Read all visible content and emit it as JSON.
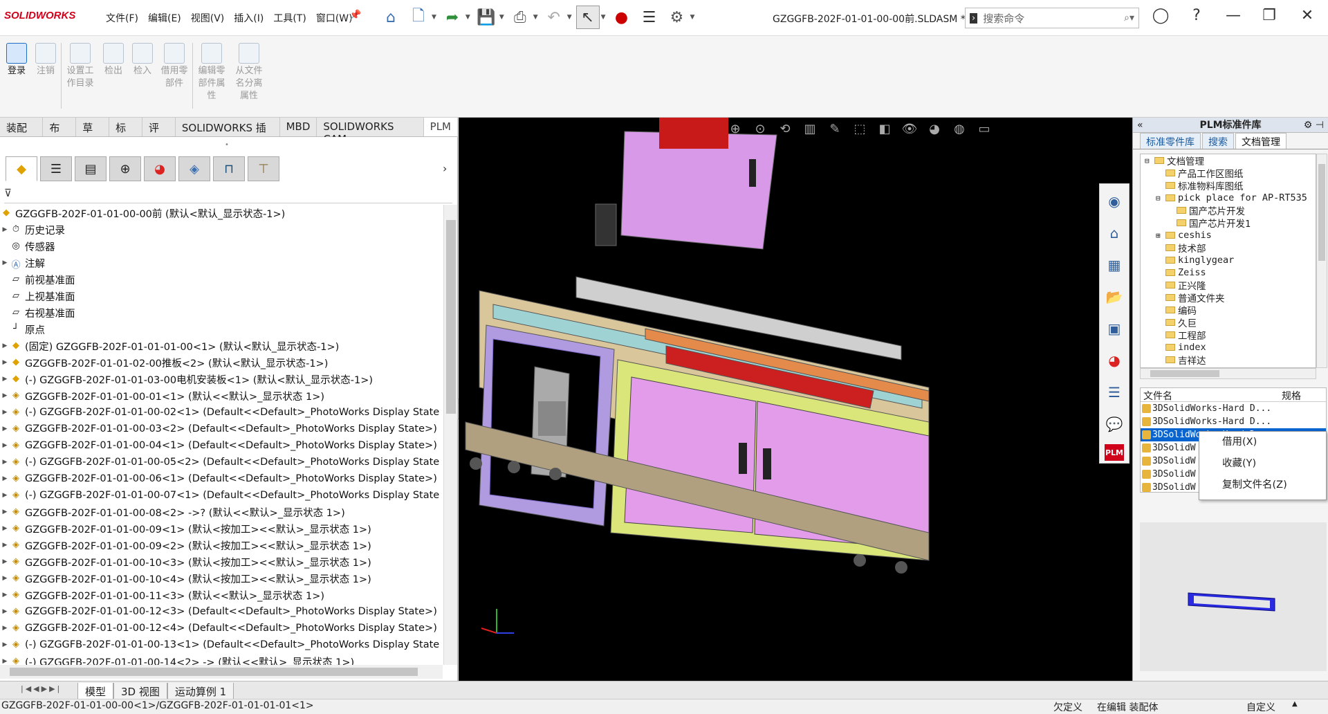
{
  "app": {
    "logo": "SOLIDWORKS",
    "doc_title": "GZGGFB-202F-01-01-00-00前.SLDASM *"
  },
  "menu": [
    "文件(F)",
    "编辑(E)",
    "视图(V)",
    "插入(I)",
    "工具(T)",
    "窗口(W)"
  ],
  "search": {
    "placeholder": "搜索命令"
  },
  "ribbon": [
    {
      "label": "登录",
      "enabled": true
    },
    {
      "label": "注销",
      "enabled": false
    },
    {
      "label": "设置工作目录",
      "enabled": false
    },
    {
      "label": "检出",
      "enabled": false
    },
    {
      "label": "检入",
      "enabled": false
    },
    {
      "label": "借用零部件",
      "enabled": false
    },
    {
      "label": "编辑零部件属性",
      "enabled": false
    },
    {
      "label": "从文件名分离属性",
      "enabled": false
    }
  ],
  "cm_tabs": [
    "装配体",
    "布局",
    "草图",
    "标注",
    "评估",
    "SOLIDWORKS 插件",
    "MBD",
    "SOLIDWORKS CAM",
    "PLM"
  ],
  "tree": {
    "root": "GZGGFB-202F-01-01-00-00前 (默认<默认_显示状态-1>)",
    "items": [
      {
        "label": "历史记录",
        "icon": "history-icon",
        "exp": true
      },
      {
        "label": "传感器",
        "icon": "sensor-icon",
        "exp": false
      },
      {
        "label": "注解",
        "icon": "annotation-icon",
        "exp": true
      },
      {
        "label": "前视基准面",
        "icon": "plane-icon",
        "exp": false
      },
      {
        "label": "上视基准面",
        "icon": "plane-icon",
        "exp": false
      },
      {
        "label": "右视基准面",
        "icon": "plane-icon",
        "exp": false
      },
      {
        "label": "原点",
        "icon": "origin-icon",
        "exp": false
      },
      {
        "label": "(固定) GZGGFB-202F-01-01-01-00<1> (默认<默认_显示状态-1>)",
        "icon": "assembly-icon",
        "exp": true
      },
      {
        "label": "GZGGFB-202F-01-01-02-00推板<2> (默认<默认_显示状态-1>)",
        "icon": "assembly-icon",
        "exp": true
      },
      {
        "label": "(-) GZGGFB-202F-01-01-03-00电机安装板<1> (默认<默认_显示状态-1>)",
        "icon": "assembly-icon",
        "exp": true
      },
      {
        "label": "GZGGFB-202F-01-01-00-01<1> (默认<<默认>_显示状态 1>)",
        "icon": "part-icon",
        "exp": true
      },
      {
        "label": "(-) GZGGFB-202F-01-01-00-02<1> (Default<<Default>_PhotoWorks Display State",
        "icon": "part-icon",
        "exp": true
      },
      {
        "label": "GZGGFB-202F-01-01-00-03<2> (Default<<Default>_PhotoWorks Display State>)",
        "icon": "part-icon",
        "exp": true
      },
      {
        "label": "GZGGFB-202F-01-01-00-04<1> (Default<<Default>_PhotoWorks Display State>)",
        "icon": "part-icon",
        "exp": true
      },
      {
        "label": "(-) GZGGFB-202F-01-01-00-05<2> (Default<<Default>_PhotoWorks Display State",
        "icon": "part-icon",
        "exp": true
      },
      {
        "label": "GZGGFB-202F-01-01-00-06<1> (Default<<Default>_PhotoWorks Display State>)",
        "icon": "part-icon",
        "exp": true
      },
      {
        "label": "(-) GZGGFB-202F-01-01-00-07<1> (Default<<Default>_PhotoWorks Display State",
        "icon": "part-icon",
        "exp": true
      },
      {
        "label": "GZGGFB-202F-01-01-00-08<2> ->? (默认<<默认>_显示状态 1>)",
        "icon": "part-icon",
        "exp": true
      },
      {
        "label": "GZGGFB-202F-01-01-00-09<1> (默认<按加工><<默认>_显示状态 1>)",
        "icon": "part-icon",
        "exp": true
      },
      {
        "label": "GZGGFB-202F-01-01-00-09<2> (默认<按加工><<默认>_显示状态 1>)",
        "icon": "part-icon",
        "exp": true
      },
      {
        "label": "GZGGFB-202F-01-01-00-10<3> (默认<按加工><<默认>_显示状态 1>)",
        "icon": "part-icon",
        "exp": true
      },
      {
        "label": "GZGGFB-202F-01-01-00-10<4> (默认<按加工><<默认>_显示状态 1>)",
        "icon": "part-icon",
        "exp": true
      },
      {
        "label": "GZGGFB-202F-01-01-00-11<3> (默认<<默认>_显示状态 1>)",
        "icon": "part-icon",
        "exp": true
      },
      {
        "label": "GZGGFB-202F-01-01-00-12<3> (Default<<Default>_PhotoWorks Display State>)",
        "icon": "part-icon",
        "exp": true
      },
      {
        "label": "GZGGFB-202F-01-01-00-12<4> (Default<<Default>_PhotoWorks Display State>)",
        "icon": "part-icon",
        "exp": true
      },
      {
        "label": "(-) GZGGFB-202F-01-01-00-13<1> (Default<<Default>_PhotoWorks Display State",
        "icon": "part-icon",
        "exp": true
      },
      {
        "label": "(-) GZGGFB-202F-01-01-00-14<2> -> (默认<<默认>_显示状态 1>)",
        "icon": "part-icon",
        "exp": true
      }
    ]
  },
  "right_panel": {
    "title": "PLM标准件库",
    "tabs": [
      "标准零件库",
      "搜索",
      "文档管理"
    ],
    "folders": [
      {
        "label": "文档管理",
        "level": 0,
        "exp": "⊟"
      },
      {
        "label": "产品工作区图纸",
        "level": 1,
        "exp": ""
      },
      {
        "label": "标准物料库图纸",
        "level": 1,
        "exp": ""
      },
      {
        "label": "pick place for AP-RT535",
        "level": 1,
        "exp": "⊟"
      },
      {
        "label": "国产芯片开发",
        "level": 2,
        "exp": ""
      },
      {
        "label": "国产芯片开发1",
        "level": 2,
        "exp": ""
      },
      {
        "label": "ceshis",
        "level": 1,
        "exp": "⊞"
      },
      {
        "label": "技术部",
        "level": 1,
        "exp": ""
      },
      {
        "label": "kinglygear",
        "level": 1,
        "exp": ""
      },
      {
        "label": "Zeiss",
        "level": 1,
        "exp": ""
      },
      {
        "label": "正兴隆",
        "level": 1,
        "exp": ""
      },
      {
        "label": "普通文件夹",
        "level": 1,
        "exp": ""
      },
      {
        "label": "编码",
        "level": 1,
        "exp": ""
      },
      {
        "label": "久巨",
        "level": 1,
        "exp": ""
      },
      {
        "label": "工程部",
        "level": 1,
        "exp": ""
      },
      {
        "label": "index",
        "level": 1,
        "exp": ""
      },
      {
        "label": "吉祥达",
        "level": 1,
        "exp": ""
      }
    ],
    "file_headers": [
      "文件名",
      "规格"
    ],
    "files": [
      {
        "name": "3DSolidWorks-Hard D...",
        "selected": false
      },
      {
        "name": "3DSolidWorks-Hard D...",
        "selected": false
      },
      {
        "name": "3DSolidWorks-Hard D",
        "selected": true
      },
      {
        "name": "3DSolidW",
        "selected": false
      },
      {
        "name": "3DSolidW",
        "selected": false
      },
      {
        "name": "3DSolidW",
        "selected": false
      },
      {
        "name": "3DSolidW",
        "selected": false
      }
    ]
  },
  "context_menu": [
    "借用(X)",
    "收藏(Y)",
    "复制文件名(Z)"
  ],
  "bottom_tabs": [
    "模型",
    "3D 视图",
    "运动算例 1"
  ],
  "status": {
    "path": "GZGGFB-202F-01-01-00-00<1>/GZGGFB-202F-01-01-01-01<1>",
    "underdefined": "欠定义",
    "editing": "在编辑 装配体",
    "custom": "自定义"
  },
  "colors": {
    "accent": "#1f6fc4",
    "viewport_bg": "#000000",
    "selection": "#0a64d0"
  }
}
